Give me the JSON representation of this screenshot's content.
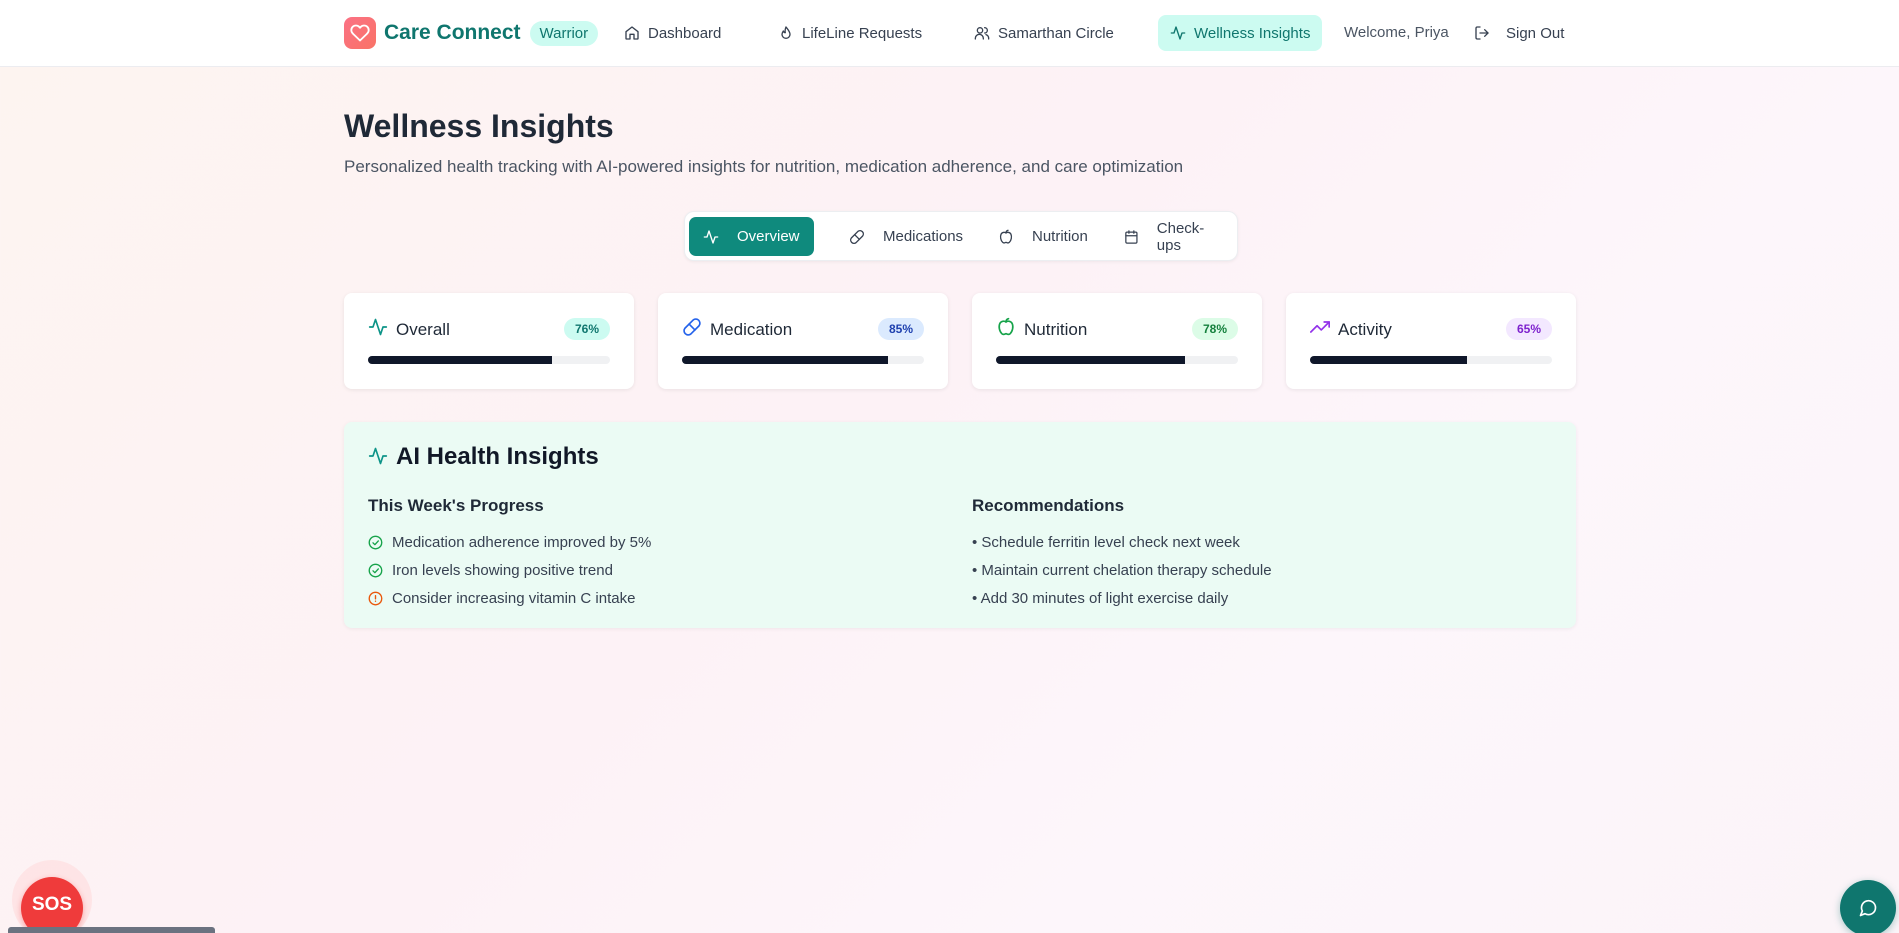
{
  "nav": {
    "brand": "Care Connect",
    "badge": "Warrior",
    "items": [
      {
        "label": "Dashboard",
        "icon": "home-icon"
      },
      {
        "label": "LifeLine Requests",
        "icon": "droplet-icon"
      },
      {
        "label": "Samarthan Circle",
        "icon": "users-icon"
      },
      {
        "label": "Wellness Insights",
        "icon": "activity-icon",
        "active": true
      }
    ],
    "welcome": "Welcome, Priya",
    "sign_out": "Sign Out"
  },
  "page": {
    "title": "Wellness Insights",
    "subtitle": "Personalized health tracking with AI-powered insights for nutrition, medication adherence, and care optimization"
  },
  "tabs": [
    {
      "label": "Overview",
      "icon": "activity-icon",
      "active": true
    },
    {
      "label": "Medications",
      "icon": "pill-icon"
    },
    {
      "label": "Nutrition",
      "icon": "apple-icon"
    },
    {
      "label": "Check-ups",
      "icon": "calendar-icon"
    }
  ],
  "metrics": [
    {
      "label": "Overall",
      "value": "76%",
      "progress": 76,
      "icon": "activity-icon",
      "badge_bg": "#ccfbf1",
      "badge_color": "#0f766e",
      "icon_color": "#0d9488"
    },
    {
      "label": "Medication",
      "value": "85%",
      "progress": 85,
      "icon": "pill-icon",
      "badge_bg": "#dbeafe",
      "badge_color": "#1e40af",
      "icon_color": "#2563eb"
    },
    {
      "label": "Nutrition",
      "value": "78%",
      "progress": 78,
      "icon": "apple-icon",
      "badge_bg": "#dcfce7",
      "badge_color": "#15803d",
      "icon_color": "#16a34a"
    },
    {
      "label": "Activity",
      "value": "65%",
      "progress": 65,
      "icon": "trending-up-icon",
      "badge_bg": "#f3e8ff",
      "badge_color": "#7e22ce",
      "icon_color": "#9333ea"
    }
  ],
  "ai": {
    "title": "AI Health Insights",
    "progress_heading": "This Week's Progress",
    "progress": [
      {
        "text": "Medication adherence improved by 5%",
        "status": "positive"
      },
      {
        "text": "Iron levels showing positive trend",
        "status": "positive"
      },
      {
        "text": "Consider increasing vitamin C intake",
        "status": "warning"
      }
    ],
    "recommendations_heading": "Recommendations",
    "recommendations": [
      "• Schedule ferritin level check next week",
      "• Maintain current chelation therapy schedule",
      "• Add 30 minutes of light exercise daily"
    ]
  },
  "sos": "SOS",
  "colors": {
    "primary": "#0f8a7d",
    "brand_text": "#0f766e",
    "sos": "#ef3b3b",
    "positive": "#16a34a",
    "warning": "#ea580c"
  }
}
